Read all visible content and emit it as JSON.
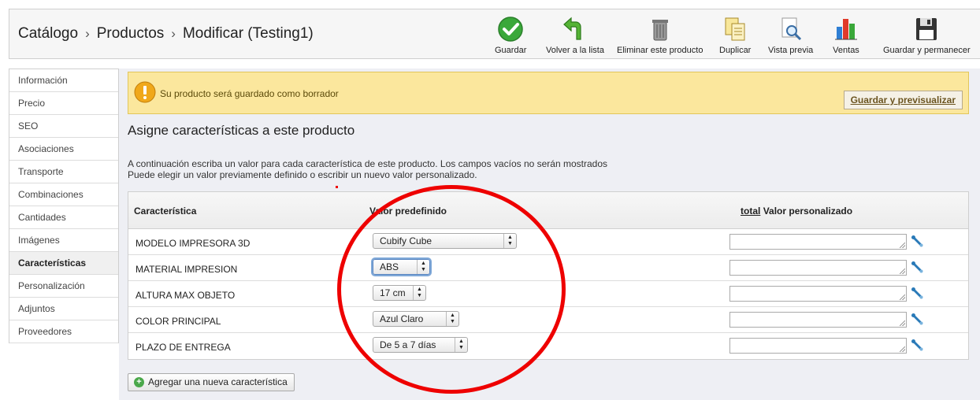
{
  "breadcrumb": {
    "items": [
      "Catálogo",
      "Productos",
      "Modificar (Testing1)"
    ],
    "separator": "›"
  },
  "toolbar": {
    "save": "Guardar",
    "back": "Volver a la lista",
    "delete": "Eliminar este producto",
    "duplicate": "Duplicar",
    "preview": "Vista previa",
    "sales": "Ventas",
    "save_stay": "Guardar y permanecer"
  },
  "sidebar": {
    "items": [
      {
        "label": "Información"
      },
      {
        "label": "Precio"
      },
      {
        "label": "SEO"
      },
      {
        "label": "Asociaciones"
      },
      {
        "label": "Transporte"
      },
      {
        "label": "Combinaciones"
      },
      {
        "label": "Cantidades"
      },
      {
        "label": "Imágenes"
      },
      {
        "label": "Características",
        "active": true
      },
      {
        "label": "Personalización"
      },
      {
        "label": "Adjuntos"
      },
      {
        "label": "Proveedores"
      }
    ]
  },
  "warning": {
    "text": "Su producto será guardado como borrador",
    "button": "Guardar y previsualizar"
  },
  "section": {
    "title": "Asigne características a este producto",
    "desc_line1": "A continuación escriba un valor para cada característica de este producto. Los campos vacíos no serán mostrados",
    "desc_line2": "Puede elegir un valor previamente definido o escribir un nuevo valor personalizado."
  },
  "table": {
    "headers": {
      "feature": "Característica",
      "predefined": "Valor predefinido",
      "total_link": "total",
      "custom": "Valor personalizado"
    },
    "rows": [
      {
        "feature": "MODELO IMPRESORA 3D",
        "value": "Cubify Cube",
        "custom": ""
      },
      {
        "feature": "MATERIAL IMPRESION",
        "value": "ABS",
        "custom": ""
      },
      {
        "feature": "ALTURA MAX OBJETO",
        "value": "17 cm",
        "custom": ""
      },
      {
        "feature": "COLOR PRINCIPAL",
        "value": "Azul Claro",
        "custom": ""
      },
      {
        "feature": "PLAZO DE ENTREGA",
        "value": "De 5 a 7 días",
        "custom": ""
      }
    ]
  },
  "add_button": "Agregar una nueva característica",
  "colors": {
    "warning_bg": "#fbe79d",
    "annotation_circle": "#ee0000",
    "main_bg": "#eeeff4"
  }
}
